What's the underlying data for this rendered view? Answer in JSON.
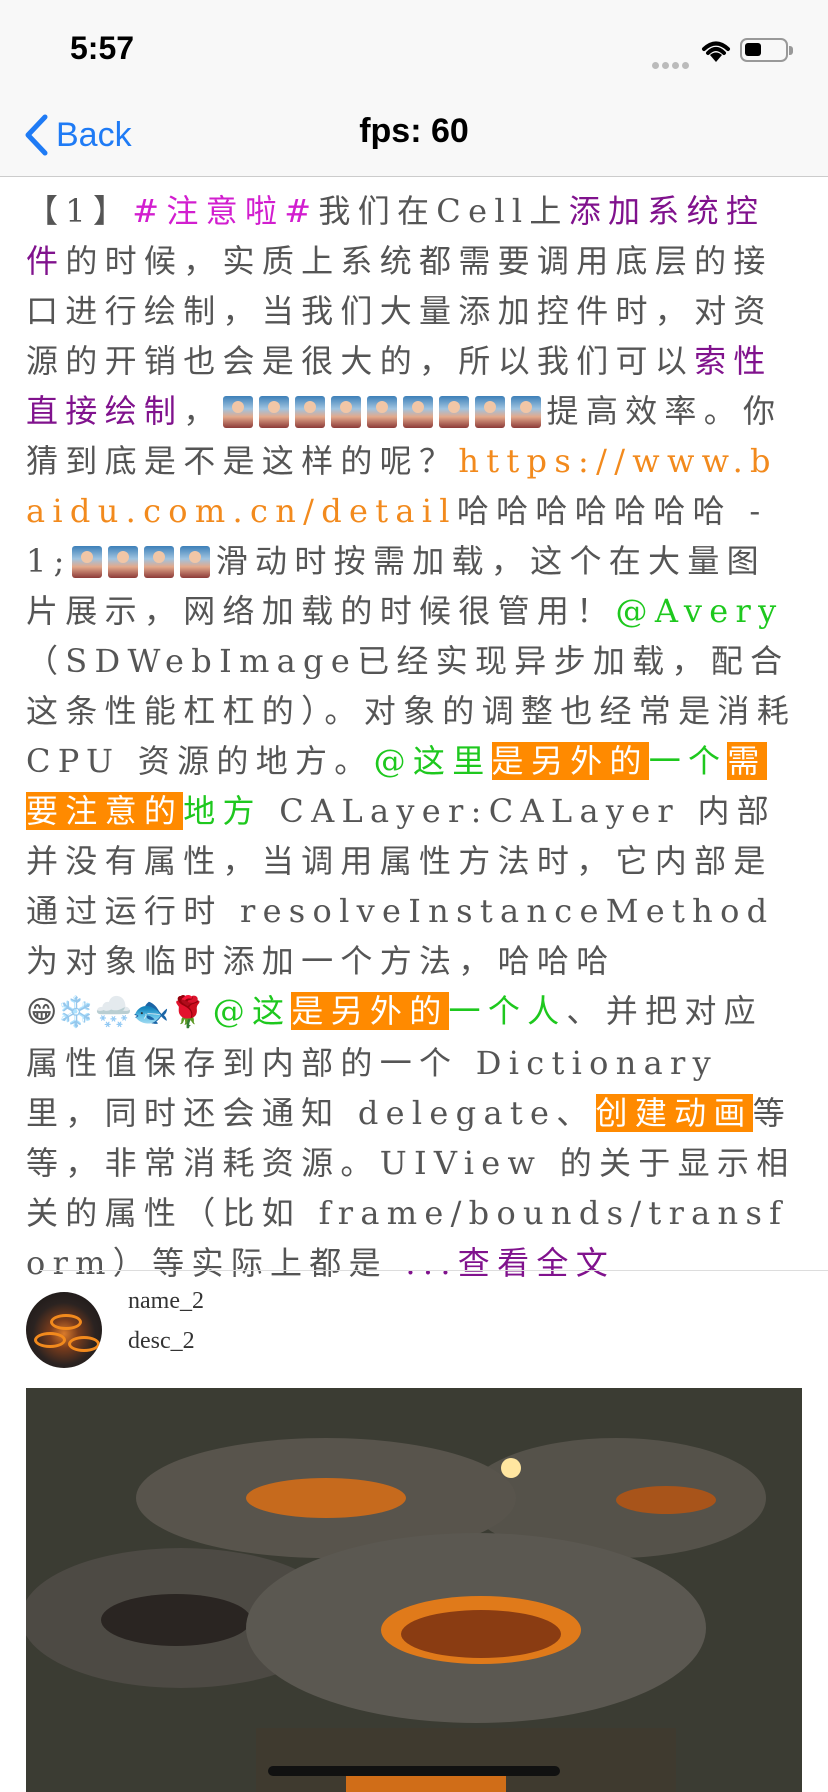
{
  "status_bar": {
    "time": "5:57"
  },
  "nav": {
    "back_label": "Back",
    "title": "fps: 60"
  },
  "post": {
    "segments": [
      {
        "t": "【1】",
        "s": "normal"
      },
      {
        "t": "#注意啦#",
        "s": "tag"
      },
      {
        "t": "我们在Cell上",
        "s": "normal"
      },
      {
        "t": "添加系统控件",
        "s": "purple"
      },
      {
        "t": "的时候，实质上系统都需要调用底层的接口进行绘制，当我们大量添加控件时，对资源的开销也会是很大的，所以我们可以",
        "s": "normal"
      },
      {
        "t": "索性直接绘制",
        "s": "purple"
      },
      {
        "t": "，",
        "s": "normal"
      },
      {
        "t": "thumbs9",
        "s": "thumbs",
        "count": 9
      },
      {
        "t": "提高效率。你猜到底是不是这样的呢？",
        "s": "normal"
      },
      {
        "t": "https://www.baidu.com.cn/detail",
        "s": "link"
      },
      {
        "t": "哈哈哈哈哈哈哈 - 1;",
        "s": "normal"
      },
      {
        "t": "thumbs4",
        "s": "thumbs",
        "count": 4
      },
      {
        "t": "滑动时按需加载，这个在大量图片展示，网络加载的时候很管用！",
        "s": "normal"
      },
      {
        "t": "@Avery",
        "s": "green"
      },
      {
        "t": "（SDWebImage已经实现异步加载，配合这条性能杠杠的）。对象的调整也经常是消耗 CPU 资源的地方。",
        "s": "normal"
      },
      {
        "t": "@这里",
        "s": "green"
      },
      {
        "t": "是另外的",
        "s": "hl"
      },
      {
        "t": "一个",
        "s": "green"
      },
      {
        "t": "需要注意的",
        "s": "hl"
      },
      {
        "t": "地方",
        "s": "green"
      },
      {
        "t": " CALayer:CALayer 内部并没有属性，当调用属性方法时，它内部是通过运行时 resolveInstanceMethod 为对象临时添加一个方法，哈哈哈",
        "s": "normal"
      },
      {
        "t": "😁❄️🌨️🐟🌹",
        "s": "emoji"
      },
      {
        "t": "@这",
        "s": "green"
      },
      {
        "t": "是另外的",
        "s": "hl"
      },
      {
        "t": "一个人",
        "s": "green"
      },
      {
        "t": "、并把对应属性值保存到内部的一个 Dictionary 里，同时还会通知 delegate、",
        "s": "normal"
      },
      {
        "t": "创建动画",
        "s": "hl"
      },
      {
        "t": "等等，非常消耗资源。UIView 的关于显示相关的属性（比如 frame/bounds/transform）等实际上都是 ",
        "s": "normal"
      },
      {
        "t": "...查看全文",
        "s": "purple"
      }
    ]
  },
  "user": {
    "name": "name_2",
    "desc": "desc_2"
  },
  "icons": {
    "back": "chevron-left-icon",
    "wifi": "wifi-icon",
    "battery": "battery-icon",
    "signal": "signal-icon"
  },
  "colors": {
    "tint": "#1f7bf5",
    "tag": "#d21ecf",
    "purple": "#80128d",
    "link": "#f28a1d",
    "green": "#1ec81e",
    "highlight": "#ff8a00"
  }
}
